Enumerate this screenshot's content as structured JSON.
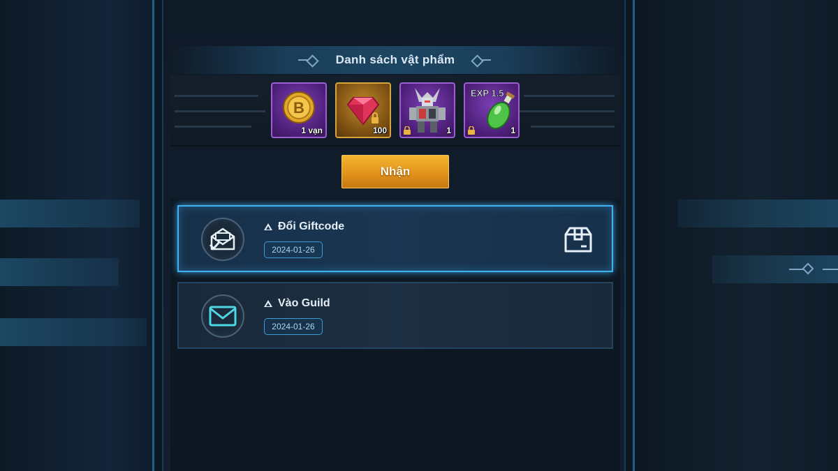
{
  "colors": {
    "accent_blue": "#3fb2f2",
    "claim_button": "#e3941c",
    "item_purple": "#9a5fd0",
    "item_gold": "#d6a63a"
  },
  "section": {
    "title": "Danh sách vật phẩm"
  },
  "items": [
    {
      "icon": "coin-b-icon",
      "qty": "1 vạn",
      "locked": false,
      "frame": "purple"
    },
    {
      "icon": "ruby-gem-icon",
      "qty": "100",
      "locked": true,
      "frame": "gold"
    },
    {
      "icon": "mech-robot-icon",
      "qty": "1",
      "locked": true,
      "frame": "purple"
    },
    {
      "icon": "exp-potion-icon",
      "qty": "1",
      "locked": true,
      "frame": "purple",
      "art_text": "EXP 1.5"
    }
  ],
  "claim_button": {
    "label": "Nhận"
  },
  "mails": [
    {
      "title": "Đổi Giftcode",
      "date": "2024-01-26",
      "icon": "opened-mail-check-icon",
      "selected": true,
      "has_attachment_icon": "gift-box-icon"
    },
    {
      "title": "Vào Guild",
      "date": "2024-01-26",
      "icon": "mail-envelope-icon",
      "selected": false
    }
  ]
}
